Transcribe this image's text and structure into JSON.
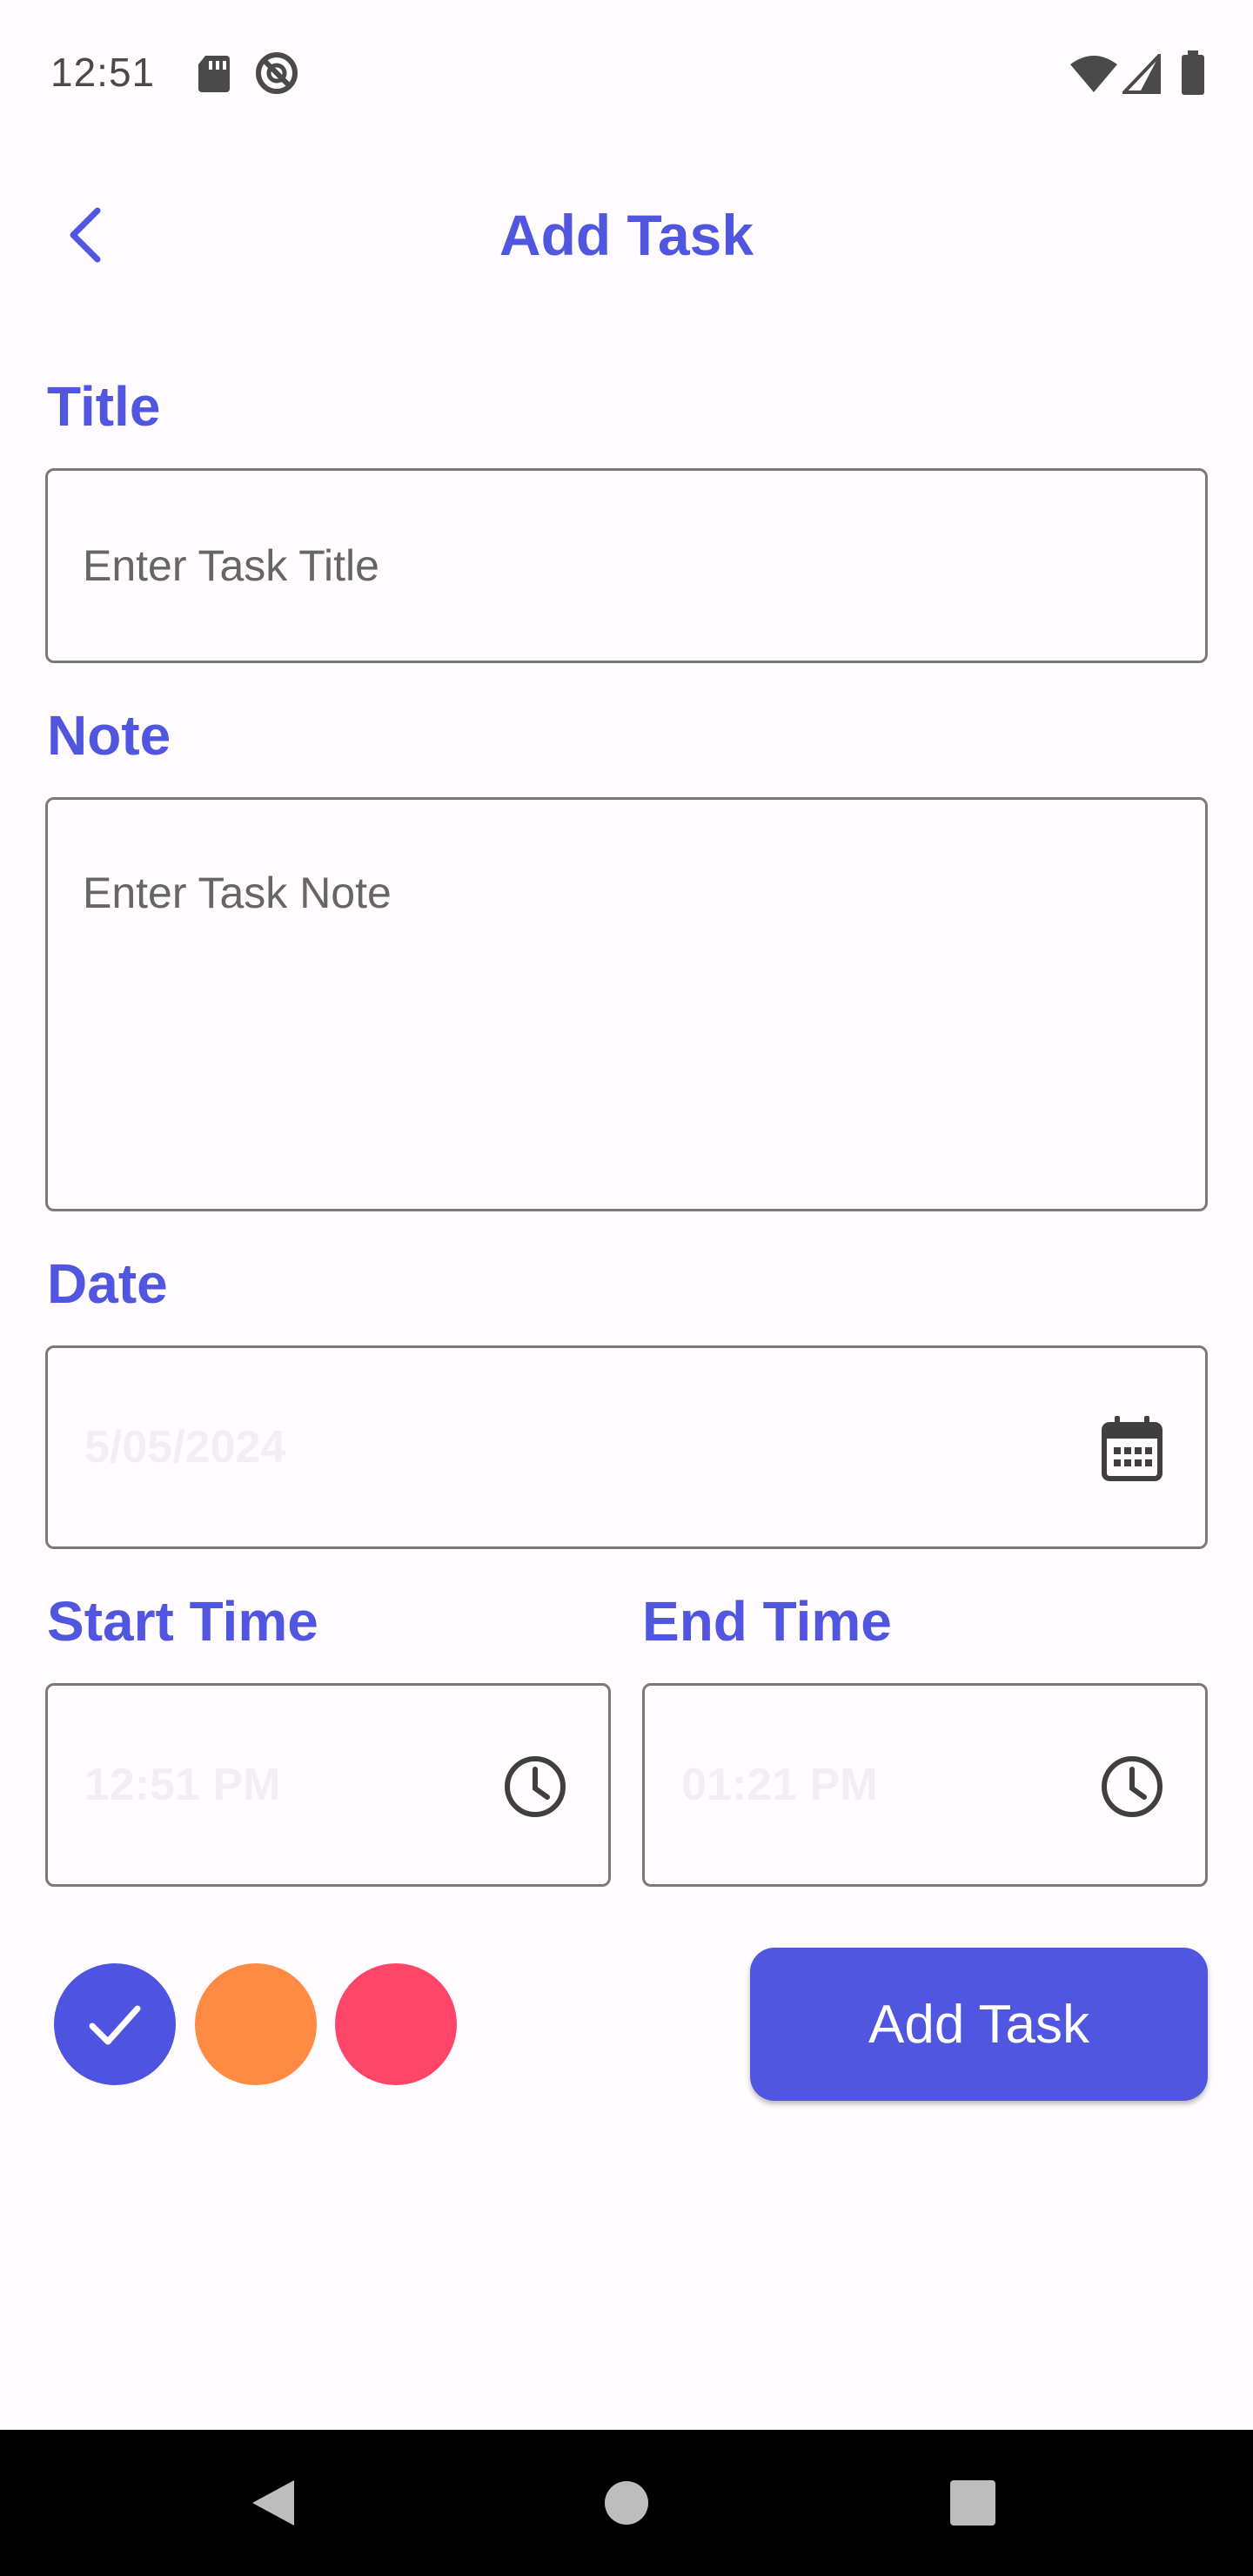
{
  "status_bar": {
    "time": "12:51",
    "icons": [
      "sd-card-icon",
      "do-not-disturb-icon",
      "wifi-icon",
      "signal-icon",
      "battery-icon"
    ]
  },
  "app_bar": {
    "title": "Add Task",
    "back_icon": "chevron-left-icon"
  },
  "form": {
    "title": {
      "label": "Title",
      "placeholder": "Enter Task Title",
      "value": ""
    },
    "note": {
      "label": "Note",
      "placeholder": "Enter Task Note",
      "value": ""
    },
    "date": {
      "label": "Date",
      "value": "5/05/2024",
      "icon": "calendar-icon"
    },
    "start_time": {
      "label": "Start Time",
      "value": "12:51 PM",
      "icon": "clock-icon"
    },
    "end_time": {
      "label": "End Time",
      "value": "01:21 PM",
      "icon": "clock-icon"
    }
  },
  "colors": {
    "options": [
      "#4e54e0",
      "#ff8a43",
      "#ff4568"
    ],
    "selected_index": 0,
    "selected_icon": "check-icon"
  },
  "submit": {
    "label": "Add Task"
  },
  "nav_bar": {
    "icons": [
      "back-triangle-icon",
      "home-circle-icon",
      "recents-square-icon"
    ]
  }
}
